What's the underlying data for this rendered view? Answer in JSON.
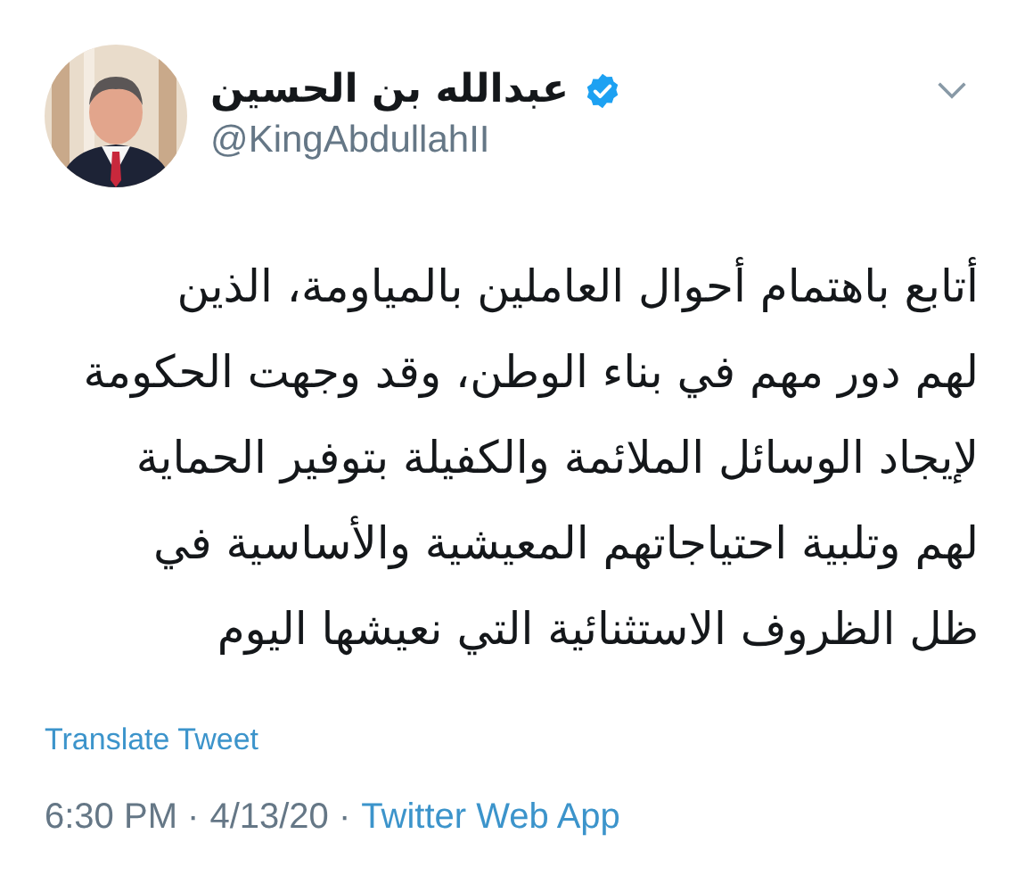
{
  "author": {
    "name": "عبدالله بن الحسين",
    "verified": true,
    "handle": "@KingAbdullahII"
  },
  "tweet": {
    "lines": [
      "أتابع باهتمام أحوال العاملين بالمياومة، الذين",
      "لهم دور مهم في بناء الوطن، وقد وجهت الحكومة",
      "لإيجاد الوسائل الملائمة والكفيلة بتوفير الحماية",
      "لهم وتلبية احتياجاتهم المعيشية والأساسية في",
      "ظل الظروف الاستثنائية التي نعيشها اليوم"
    ]
  },
  "translate_link": "Translate Tweet",
  "meta": {
    "time": "6:30 PM ·",
    "date": "4/13/20 ·",
    "source": "Twitter Web App"
  }
}
